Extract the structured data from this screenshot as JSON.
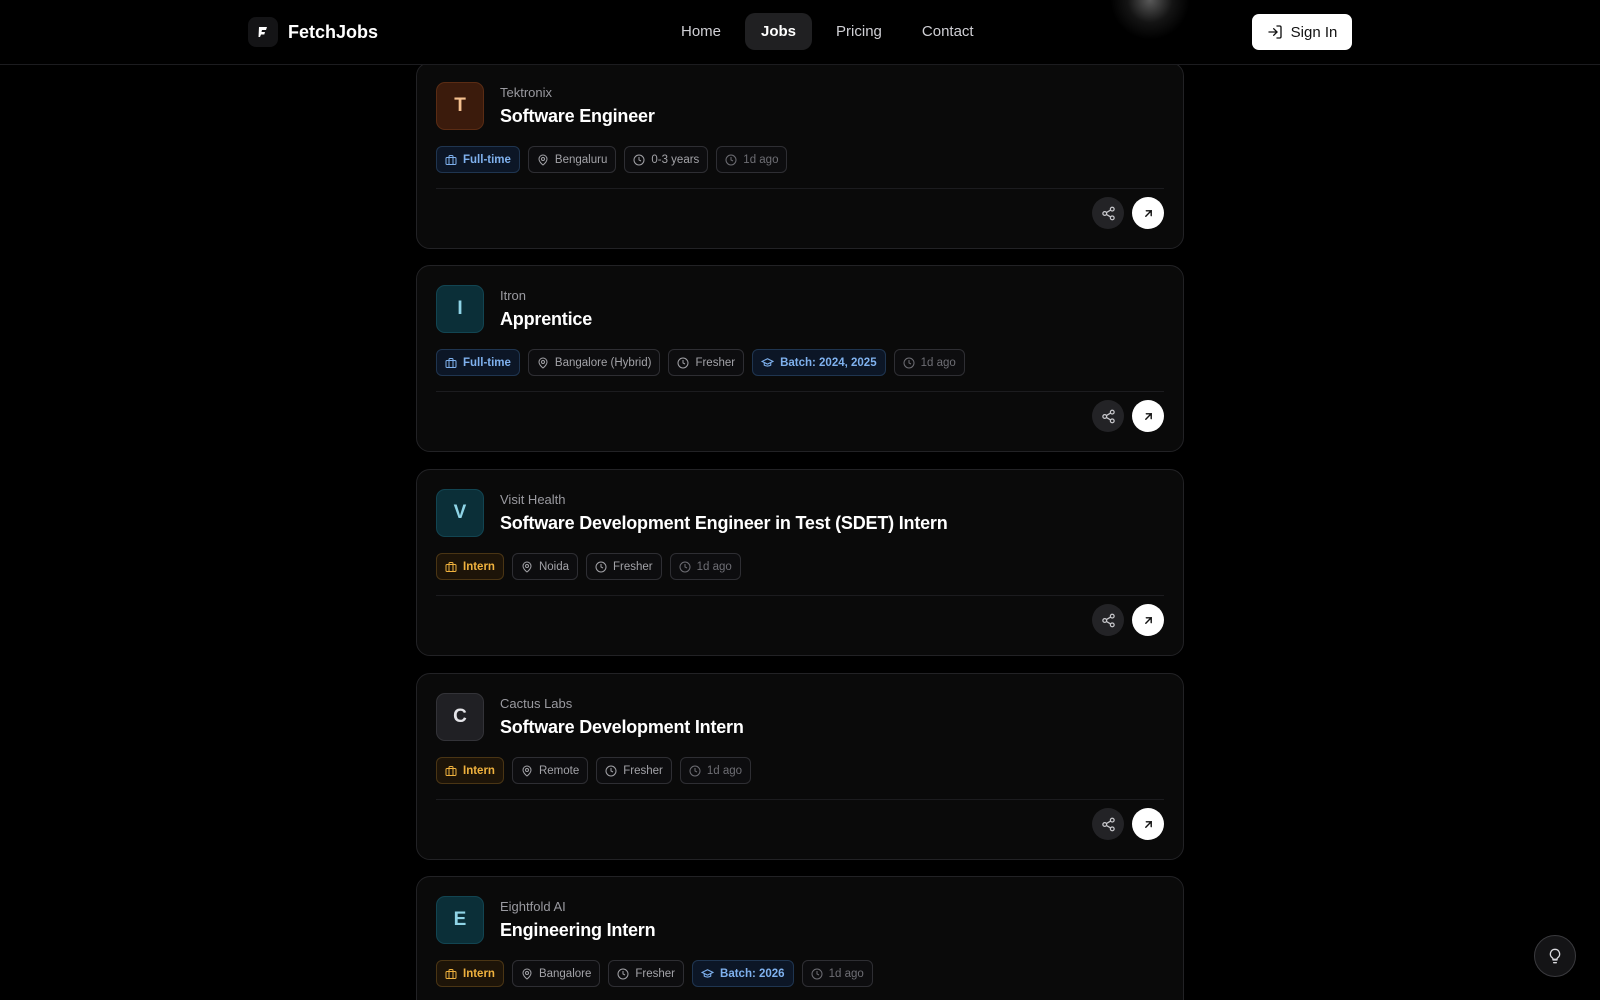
{
  "header": {
    "brand": "FetchJobs",
    "nav": [
      {
        "label": "Home",
        "active": false
      },
      {
        "label": "Jobs",
        "active": true
      },
      {
        "label": "Pricing",
        "active": false
      },
      {
        "label": "Contact",
        "active": false
      }
    ],
    "signin_label": "Sign In"
  },
  "jobs": [
    {
      "company": "Tektronix",
      "initial": "T",
      "title": "Software Engineer",
      "avatar_bg": "#3b1b0c",
      "avatar_fg": "#f4c08f",
      "type": "Full-time",
      "location": "Bengaluru",
      "experience": "0-3 years",
      "batch": "",
      "posted": "1d ago"
    },
    {
      "company": "Itron",
      "initial": "I",
      "title": "Apprentice",
      "avatar_bg": "#0b2f38",
      "avatar_fg": "#8fd4e6",
      "type": "Full-time",
      "location": "Bangalore (Hybrid)",
      "experience": "Fresher",
      "batch": "Batch: 2024, 2025",
      "posted": "1d ago"
    },
    {
      "company": "Visit Health",
      "initial": "V",
      "title": "Software Development Engineer in Test (SDET) Intern",
      "avatar_bg": "#0b2f38",
      "avatar_fg": "#8fd4e6",
      "type": "Intern",
      "location": "Noida",
      "experience": "Fresher",
      "batch": "",
      "posted": "1d ago"
    },
    {
      "company": "Cactus Labs",
      "initial": "C",
      "title": "Software Development Intern",
      "avatar_bg": "#202024",
      "avatar_fg": "#e4e4e8",
      "type": "Intern",
      "location": "Remote",
      "experience": "Fresher",
      "batch": "",
      "posted": "1d ago"
    },
    {
      "company": "Eightfold AI",
      "initial": "E",
      "title": "Engineering Intern",
      "avatar_bg": "#0b2f38",
      "avatar_fg": "#8fd4e6",
      "type": "Intern",
      "location": "Bangalore",
      "experience": "Fresher",
      "batch": "Batch: 2026",
      "posted": "1d ago"
    }
  ],
  "colors": {
    "accent_fulltime": "#7fb1ee",
    "accent_intern": "#f0b23e",
    "background": "#000000"
  },
  "icons": {
    "brand": "fetchjobs-logo-icon",
    "signin": "sign-in-icon",
    "type": "briefcase-icon",
    "location": "map-pin-icon",
    "experience": "clock-icon",
    "batch": "graduation-cap-icon",
    "posted": "clock-icon",
    "share": "share-icon",
    "open": "arrow-up-right-icon",
    "help": "lightbulb-icon"
  }
}
